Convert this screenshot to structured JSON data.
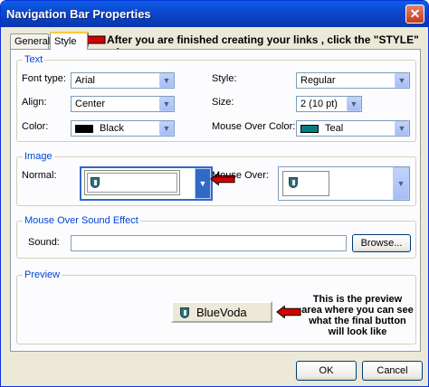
{
  "window": {
    "title": "Navigation Bar Properties",
    "close_glyph": "✕"
  },
  "tabs": [
    {
      "label": "General"
    },
    {
      "label": "Style"
    }
  ],
  "annotations": {
    "tab_hint": "After you are finished creating your links , click the \"STYLE\" tab",
    "preview_callout": "This is the preview area where you can see what the final button will look like"
  },
  "text_group": {
    "legend": "Text",
    "font_type": {
      "label": "Font type:",
      "value": "Arial"
    },
    "align": {
      "label": "Align:",
      "value": "Center"
    },
    "color": {
      "label": "Color:",
      "value": "Black",
      "swatch": "#000000"
    },
    "style": {
      "label": "Style:",
      "value": "Regular"
    },
    "size": {
      "label": "Size:",
      "value": "2 (10 pt)"
    },
    "mouse_over_color": {
      "label": "Mouse Over Color:",
      "value": "Teal",
      "swatch": "#008080"
    }
  },
  "image_group": {
    "legend": "Image",
    "normal_label": "Normal:",
    "mouse_over_label": "Mouse Over:"
  },
  "sound_group": {
    "legend": "Mouse Over Sound Effect",
    "sound_label": "Sound:",
    "sound_value": "",
    "browse_label": "Browse..."
  },
  "preview_group": {
    "legend": "Preview",
    "button_text": "BlueVoda"
  },
  "footer": {
    "ok_label": "OK",
    "cancel_label": "Cancel"
  },
  "colors": {
    "accent": "#0046d5",
    "arrow_red": "#d40000",
    "title_blue": "#0a5fe6"
  }
}
